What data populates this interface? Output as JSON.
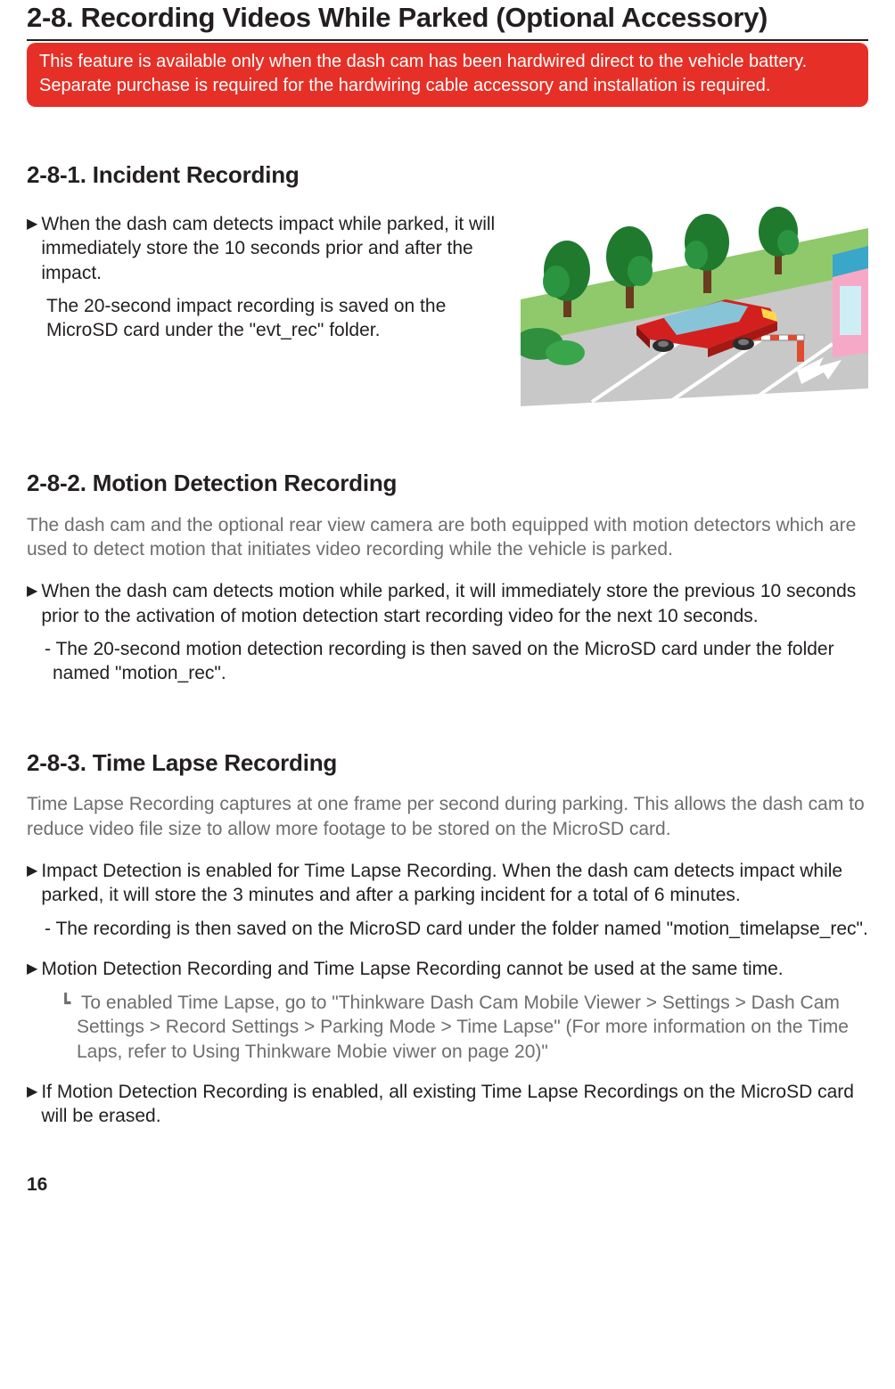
{
  "page_number": "16",
  "main_heading": "2-8. Recording Videos While Parked (Optional Accessory)",
  "red_banner": "This feature is available only when the dash cam  has been hardwired direct to the vehicle battery. Separate purchase is required for the hardwiring cable accessory and installation is required.",
  "section_281": {
    "heading": "2-8-1. Incident Recording",
    "bullet1": "When the dash cam  detects impact while parked, it will immediately store the 10 seconds prior and after the impact.",
    "note1": "The 20-second impact recording is saved on the MicroSD card under the \"evt_rec\" folder.",
    "illustration_alt": "parking-lot-incident-illustration"
  },
  "section_282": {
    "heading": "2-8-2. Motion Detection Recording",
    "intro": "The dash cam and the optional rear view camera are both equipped with motion detectors which are used to detect motion that initiates video recording while the vehicle is parked.",
    "bullet1": "When the dash cam detects motion while parked, it will immediately store the previous 10 seconds prior to the activation of motion detection start recording video for the next 10 seconds.",
    "dash1": "- The 20-second motion detection recording is then saved on the MicroSD card under the folder named \"motion_rec\"."
  },
  "section_283": {
    "heading": "2-8-3. Time Lapse Recording",
    "intro": "Time Lapse Recording captures at one frame per second during parking. This allows the dash cam to reduce video file size to allow more footage to be stored on the MicroSD card.",
    "bullet1": " Impact Detection is enabled for Time Lapse Recording. When the dash cam detects impact while parked, it will store the 3 minutes and after a parking incident for a total of 6 minutes.",
    "dash1": "- The recording is then saved on the MicroSD card under the folder named \"motion_timelapse_rec\".",
    "bullet2": " Motion Detection Recording and Time Lapse Recording cannot be used at the same time.",
    "subnote_prefix": "┗ ",
    "subnote": "To enabled Time Lapse, go to \"Thinkware Dash Cam Mobile Viewer > Settings > Dash Cam Settings > Record Settings > Parking Mode > Time Lapse\" (For more information on the Time Laps, refer to Using Thinkware Mobie viwer on page 20)\"",
    "bullet3": " If Motion Detection Recording is enabled, all existing Time Lapse Recordings on the MicroSD card will be erased."
  }
}
